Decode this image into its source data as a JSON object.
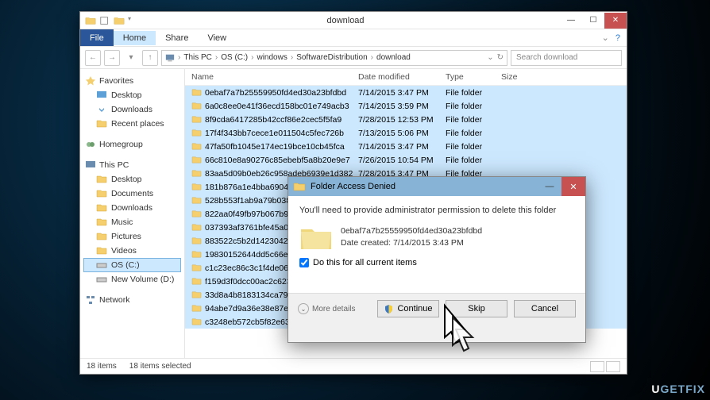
{
  "window": {
    "title": "download",
    "menu": {
      "file": "File",
      "home": "Home",
      "share": "Share",
      "view": "View"
    },
    "breadcrumb": [
      "This PC",
      "OS (C:)",
      "windows",
      "SoftwareDistribution",
      "download"
    ],
    "search_placeholder": "Search download",
    "help_icon": "?"
  },
  "sidebar": {
    "favorites": {
      "label": "Favorites",
      "items": [
        "Desktop",
        "Downloads",
        "Recent places"
      ]
    },
    "homegroup": {
      "label": "Homegroup"
    },
    "thispc": {
      "label": "This PC",
      "items": [
        "Desktop",
        "Documents",
        "Downloads",
        "Music",
        "Pictures",
        "Videos",
        "OS (C:)",
        "New Volume (D:)"
      ]
    },
    "network": {
      "label": "Network"
    }
  },
  "filelist": {
    "columns": {
      "name": "Name",
      "date": "Date modified",
      "type": "Type",
      "size": "Size"
    },
    "rows": [
      {
        "name": "0ebaf7a7b25559950fd4ed30a23bfdbd",
        "date": "7/14/2015 3:47 PM",
        "type": "File folder"
      },
      {
        "name": "6a0c8ee0e41f36ecd158bc01e749acb3",
        "date": "7/14/2015 3:59 PM",
        "type": "File folder"
      },
      {
        "name": "8f9cda6417285b42ccf86e2cec5f5fa9",
        "date": "7/28/2015 12:53 PM",
        "type": "File folder"
      },
      {
        "name": "17f4f343bb7cece1e011504c5fec726b",
        "date": "7/13/2015 5:06 PM",
        "type": "File folder"
      },
      {
        "name": "47fa50fb1045e174ec19bce10cb45fca",
        "date": "7/14/2015 3:47 PM",
        "type": "File folder"
      },
      {
        "name": "66c810e8a90276c85ebebf5a8b20e9e7",
        "date": "7/26/2015 10:54 PM",
        "type": "File folder"
      },
      {
        "name": "83aa5d09b0eb26c958adeb6939e1d382",
        "date": "7/28/2015 3:47 PM",
        "type": "File folder"
      },
      {
        "name": "181b876a1e4bba6904551f19e0",
        "date": "",
        "type": ""
      },
      {
        "name": "528b553f1ab9a79b03899f9b4",
        "date": "",
        "type": ""
      },
      {
        "name": "822aa0f49fb97b067b97f56e912",
        "date": "",
        "type": ""
      },
      {
        "name": "037393af3761bfe45a011c5c715",
        "date": "",
        "type": ""
      },
      {
        "name": "883522c5b2d1423042eddf6a8e",
        "date": "",
        "type": ""
      },
      {
        "name": "19830152644dd5c66e602d36ad",
        "date": "",
        "type": ""
      },
      {
        "name": "c1c23ec86c3c1f4de065ffa936b",
        "date": "",
        "type": ""
      },
      {
        "name": "f159d3f0dcc00ac2c6232a5ebf9",
        "date": "",
        "type": ""
      },
      {
        "name": "33d8a4b8183134ca79120bb436",
        "date": "",
        "type": ""
      },
      {
        "name": "94abe7d9a36e38e87eeb46d8161",
        "date": "",
        "type": ""
      },
      {
        "name": "c3248eb572cb5f82e63ce9c6d7",
        "date": "",
        "type": ""
      }
    ]
  },
  "statusbar": {
    "items": "18 items",
    "selected": "18 items selected"
  },
  "dialog": {
    "title": "Folder Access Denied",
    "message": "You'll need to provide administrator permission to delete this folder",
    "file_name": "0ebaf7a7b25559950fd4ed30a23bfdbd",
    "file_date_label": "Date created: 7/14/2015 3:43 PM",
    "checkbox": "Do this for all current items",
    "continue": "Continue",
    "skip": "Skip",
    "cancel": "Cancel",
    "more": "More details"
  },
  "watermark": "UGETFIX"
}
